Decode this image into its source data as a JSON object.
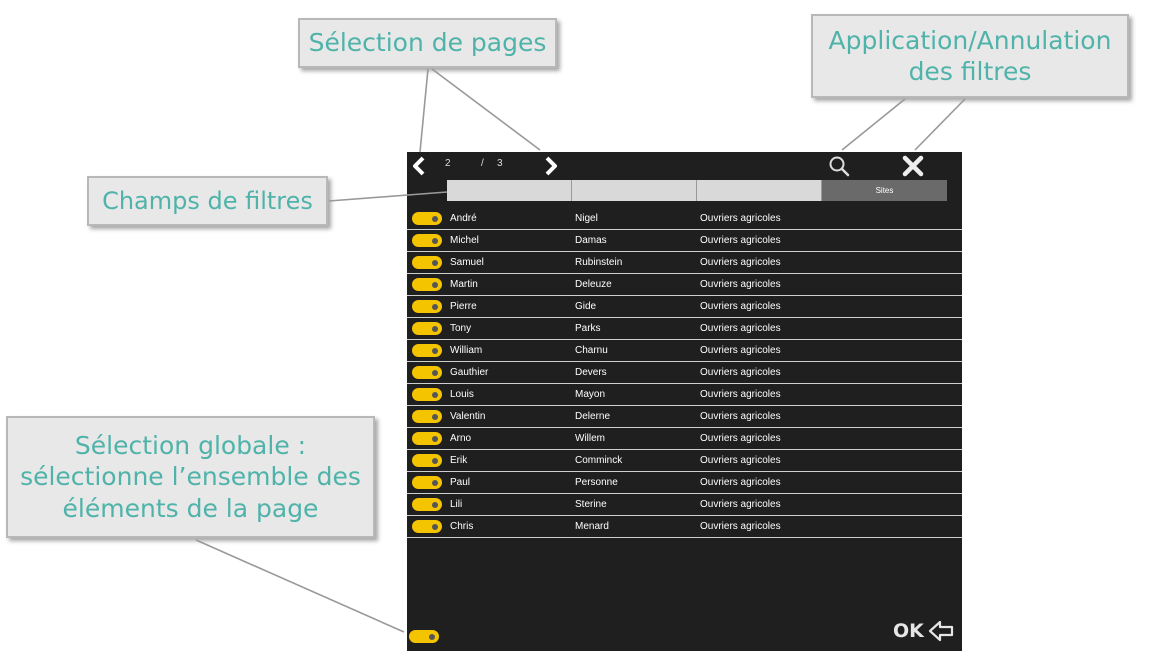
{
  "callouts": {
    "pages": "Sélection de pages",
    "apply": "Application/Annulation\ndes filtres",
    "fields": "Champs de filtres",
    "global": "Sélection globale :\nsélectionne l’ensemble des\néléments de la page"
  },
  "pagination": {
    "current": "2",
    "separator": "/",
    "total": "3"
  },
  "filters": {
    "field1": "",
    "field2": "",
    "field3": "",
    "site_label": "Sites"
  },
  "rows": [
    {
      "first": "André",
      "last": "Nigel",
      "group": "Ouvriers agricoles"
    },
    {
      "first": "Michel",
      "last": "Damas",
      "group": "Ouvriers agricoles"
    },
    {
      "first": "Samuel",
      "last": "Rubinstein",
      "group": "Ouvriers agricoles"
    },
    {
      "first": "Martin",
      "last": "Deleuze",
      "group": "Ouvriers agricoles"
    },
    {
      "first": "Pierre",
      "last": "Gide",
      "group": "Ouvriers agricoles"
    },
    {
      "first": "Tony",
      "last": "Parks",
      "group": "Ouvriers agricoles"
    },
    {
      "first": "William",
      "last": "Charnu",
      "group": "Ouvriers agricoles"
    },
    {
      "first": "Gauthier",
      "last": "Devers",
      "group": "Ouvriers agricoles"
    },
    {
      "first": "Louis",
      "last": "Mayon",
      "group": "Ouvriers agricoles"
    },
    {
      "first": "Valentin",
      "last": "Delerne",
      "group": "Ouvriers agricoles"
    },
    {
      "first": "Arno",
      "last": "Willem",
      "group": "Ouvriers agricoles"
    },
    {
      "first": "Erik",
      "last": "Comminck",
      "group": "Ouvriers agricoles"
    },
    {
      "first": "Paul",
      "last": "Personne",
      "group": "Ouvriers agricoles"
    },
    {
      "first": "Lili",
      "last": "Sterine",
      "group": "Ouvriers agricoles"
    },
    {
      "first": "Chris",
      "last": "Menard",
      "group": "Ouvriers agricoles"
    }
  ],
  "footer": {
    "ok_label": "OK"
  },
  "icons": {
    "prev": "chevron-left-icon",
    "next": "chevron-right-icon",
    "search": "search-icon",
    "clear": "close-icon",
    "ok": "arrow-left-icon"
  },
  "colors": {
    "toggle": "#f5c400",
    "panel": "#1f1f1f",
    "callout_text": "#4fb3aa"
  }
}
